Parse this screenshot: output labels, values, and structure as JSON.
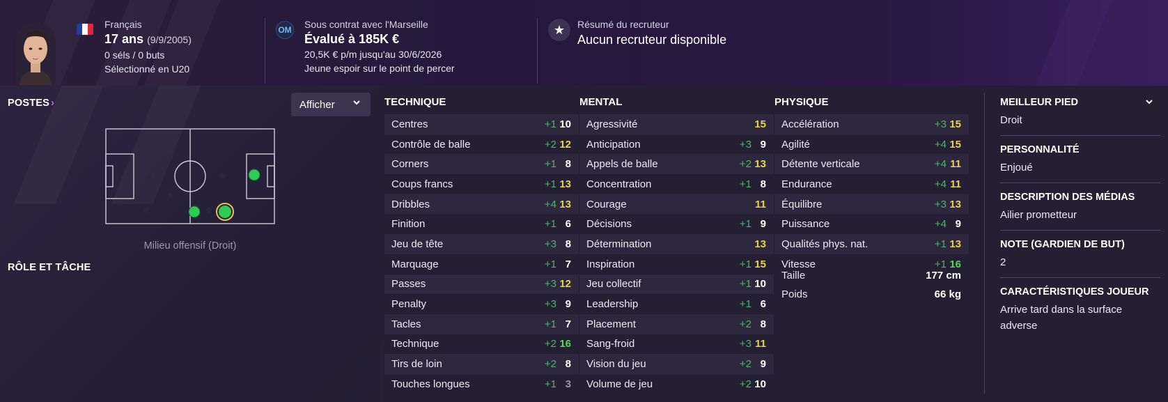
{
  "header": {
    "nationality": "Français",
    "age": "17 ans",
    "birthdate": "(9/9/2005)",
    "caps": "0 séls / 0 buts",
    "selection": "Sélectionné en U20",
    "contract_title": "Sous contrat avec l'Marseille",
    "value": "Évalué à 185K €",
    "wage": "20,5K € p/m jusqu'au 30/6/2026",
    "status": "Jeune espoir sur le point de percer",
    "scout_title": "Résumé du recruteur",
    "scout_value": "Aucun recruteur disponible",
    "flag_colors": [
      "#1f3f9a",
      "#ffffff",
      "#e0283a"
    ],
    "club_badge": "OM"
  },
  "positions": {
    "title": "POSTES",
    "chevron": "›",
    "show_button": "Afficher",
    "caption": "Milieu offensif (Droit)",
    "role_title": "RÔLE ET TÂCHE"
  },
  "columns": [
    {
      "title": "TECHNIQUE",
      "rows": [
        {
          "name": "Centres",
          "delta": "+1",
          "value": "10",
          "color": "white"
        },
        {
          "name": "Contrôle de balle",
          "delta": "+2",
          "value": "12",
          "color": "yellow"
        },
        {
          "name": "Corners",
          "delta": "+1",
          "value": "8",
          "color": "white"
        },
        {
          "name": "Coups francs",
          "delta": "+1",
          "value": "13",
          "color": "yellow"
        },
        {
          "name": "Dribbles",
          "delta": "+4",
          "value": "13",
          "color": "yellow"
        },
        {
          "name": "Finition",
          "delta": "+1",
          "value": "6",
          "color": "white"
        },
        {
          "name": "Jeu de tête",
          "delta": "+3",
          "value": "8",
          "color": "white"
        },
        {
          "name": "Marquage",
          "delta": "+1",
          "value": "7",
          "color": "white"
        },
        {
          "name": "Passes",
          "delta": "+3",
          "value": "12",
          "color": "yellow"
        },
        {
          "name": "Penalty",
          "delta": "+3",
          "value": "9",
          "color": "white"
        },
        {
          "name": "Tacles",
          "delta": "+1",
          "value": "7",
          "color": "white"
        },
        {
          "name": "Technique",
          "delta": "+2",
          "value": "16",
          "color": "green"
        },
        {
          "name": "Tirs de loin",
          "delta": "+2",
          "value": "8",
          "color": "white"
        },
        {
          "name": "Touches longues",
          "delta": "+1",
          "value": "3",
          "color": "grey"
        }
      ]
    },
    {
      "title": "MENTAL",
      "rows": [
        {
          "name": "Agressivité",
          "delta": "",
          "value": "15",
          "color": "yellow"
        },
        {
          "name": "Anticipation",
          "delta": "+3",
          "value": "9",
          "color": "white"
        },
        {
          "name": "Appels de balle",
          "delta": "+2",
          "value": "13",
          "color": "yellow"
        },
        {
          "name": "Concentration",
          "delta": "+1",
          "value": "8",
          "color": "white"
        },
        {
          "name": "Courage",
          "delta": "",
          "value": "11",
          "color": "yellow"
        },
        {
          "name": "Décisions",
          "delta": "+1",
          "value": "9",
          "color": "white"
        },
        {
          "name": "Détermination",
          "delta": "",
          "value": "13",
          "color": "yellow"
        },
        {
          "name": "Inspiration",
          "delta": "+1",
          "value": "15",
          "color": "yellow"
        },
        {
          "name": "Jeu collectif",
          "delta": "+1",
          "value": "10",
          "color": "white"
        },
        {
          "name": "Leadership",
          "delta": "+1",
          "value": "6",
          "color": "white"
        },
        {
          "name": "Placement",
          "delta": "+2",
          "value": "8",
          "color": "white"
        },
        {
          "name": "Sang-froid",
          "delta": "+3",
          "value": "11",
          "color": "yellow"
        },
        {
          "name": "Vision du jeu",
          "delta": "+2",
          "value": "9",
          "color": "white"
        },
        {
          "name": "Volume de jeu",
          "delta": "+2",
          "value": "10",
          "color": "white"
        }
      ]
    },
    {
      "title": "PHYSIQUE",
      "rows": [
        {
          "name": "Accélération",
          "delta": "+3",
          "value": "15",
          "color": "yellow"
        },
        {
          "name": "Agilité",
          "delta": "+4",
          "value": "15",
          "color": "yellow"
        },
        {
          "name": "Détente verticale",
          "delta": "+4",
          "value": "11",
          "color": "yellow"
        },
        {
          "name": "Endurance",
          "delta": "+4",
          "value": "11",
          "color": "yellow"
        },
        {
          "name": "Équilibre",
          "delta": "+3",
          "value": "13",
          "color": "yellow"
        },
        {
          "name": "Puissance",
          "delta": "+4",
          "value": "9",
          "color": "white"
        },
        {
          "name": "Qualités phys. nat.",
          "delta": "+1",
          "value": "13",
          "color": "yellow"
        },
        {
          "name": "Vitesse",
          "delta": "+1",
          "value": "16",
          "color": "green"
        }
      ]
    }
  ],
  "physical_extra": [
    {
      "name": "Taille",
      "value": "177 cm"
    },
    {
      "name": "Poids",
      "value": "66 kg"
    }
  ],
  "info": [
    {
      "label": "MEILLEUR PIED",
      "value": "Droit",
      "chevron": "⌄"
    },
    {
      "label": "PERSONNALITÉ",
      "value": "Enjoué"
    },
    {
      "label": "DESCRIPTION DES MÉDIAS",
      "value": "Ailier prometteur"
    },
    {
      "label": "NOTE (GARDIEN DE BUT)",
      "value": "2"
    },
    {
      "label": "CARACTÉRISTIQUES JOUEUR",
      "value": "Arrive tard dans la surface adverse"
    }
  ],
  "colors": {
    "white": "#ffffff",
    "yellow": "#e8d44a",
    "green": "#55d85a",
    "grey": "#9c97ad",
    "delta": "#4fb36b"
  }
}
